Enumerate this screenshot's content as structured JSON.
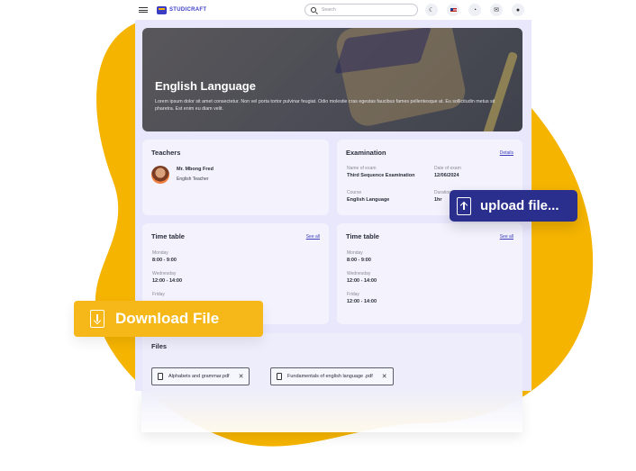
{
  "navbar": {
    "brand": "STUDICRAFT",
    "search_placeholder": "Search"
  },
  "hero": {
    "title": "English Language",
    "description": "Lorem ipsum dolor sit amet consectetur. Non vel porta tortor pulvinar feugiat. Odio molestie cras egestas faucibus fames pellentesque at. Eu sollicitudin metus sit pharetra. Est enim eu diam velit."
  },
  "teachers": {
    "title": "Teachers",
    "name": "Mr. Mbong Fred",
    "role": "English Teacher"
  },
  "examination": {
    "title": "Examination",
    "link": "Details",
    "name_label": "Name of exam",
    "name_value": "Third Sequence Examination",
    "date_label": "Date of exam",
    "date_value": "12/06/2024",
    "course_label": "Course",
    "course_value": "English Language",
    "duration_label": "Duration",
    "duration_value": "1hr"
  },
  "timetable_left": {
    "title": "Time table",
    "link": "See all",
    "entries": [
      {
        "day": "Monday",
        "time": "8:00 - 9:00"
      },
      {
        "day": "Wednesday",
        "time": "12:00 - 14:00"
      },
      {
        "day": "Friday",
        "time": ""
      }
    ]
  },
  "timetable_right": {
    "title": "Time table",
    "link": "See all",
    "entries": [
      {
        "day": "Monday",
        "time": "8:00 - 9:00"
      },
      {
        "day": "Wednesday",
        "time": "12:00 - 14:00"
      },
      {
        "day": "Friday",
        "time": "12:00 - 14:00"
      }
    ]
  },
  "files": {
    "title": "Files",
    "items": [
      "Alphabets and grammar.pdf",
      "Fundamentals of english language .pdf"
    ]
  },
  "badges": {
    "download": "Download File",
    "upload": "upload file..."
  },
  "colors": {
    "accent_yellow": "#f6b818",
    "brand_navy": "#2a2e8c",
    "link_blue": "#3d3dbb"
  }
}
